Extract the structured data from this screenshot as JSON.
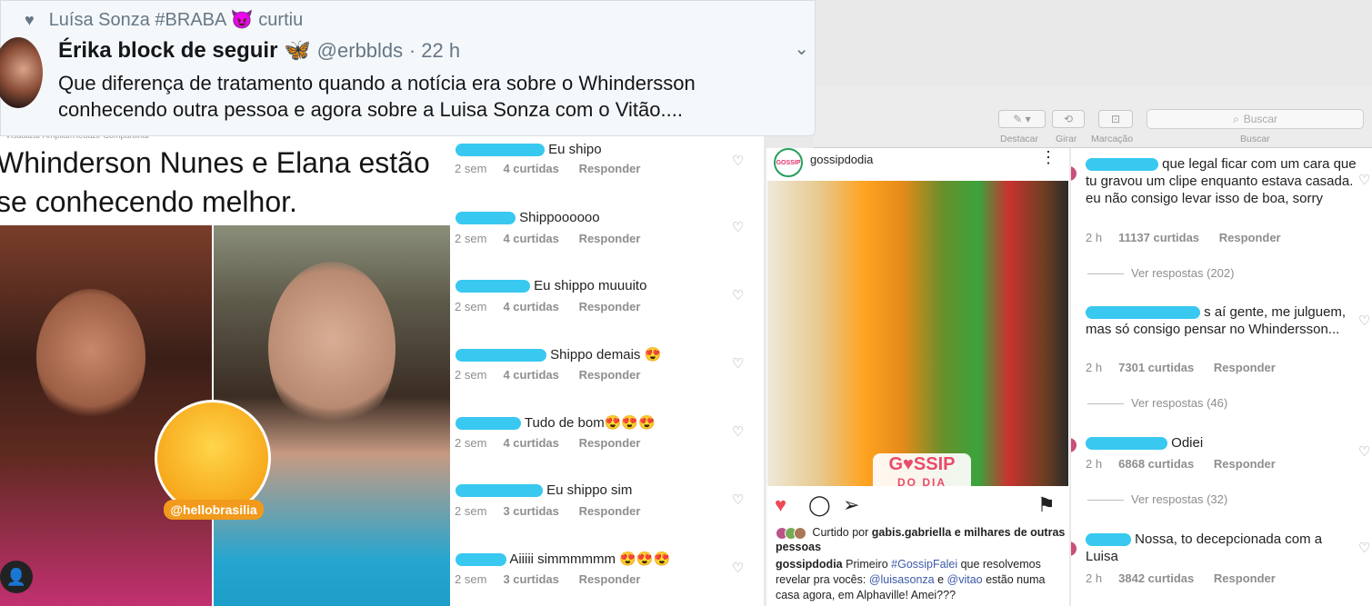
{
  "tweet": {
    "liked_by": "Luísa Sonza #BRABA",
    "liked_emoji": "😈",
    "liked_action": "curtiu",
    "author_name": "Érika block de seguir",
    "author_emoji": "🦋",
    "handle": "@erbblds",
    "time": "· 22 h",
    "text": "Que diferença de tratamento quando a notícia era sobre o Whindersson conhecendo outra pessoa e agora sobre a Luisa Sonza com o Vitão...."
  },
  "preview_toolbar": {
    "buttons": [
      "Destacar",
      "Girar",
      "Marcação",
      "Buscar"
    ],
    "search_placeholder": "Buscar"
  },
  "article": {
    "mini_toolbar": "Visualizar   Ampliar/Reduzir   Compartilhar",
    "headline_line1": "Whinderson Nunes e Elana estão",
    "headline_line2": "se conhecendo melhor.",
    "badge_label": "@hellobrasilia"
  },
  "comments_left": [
    {
      "text": "Eu shipo",
      "time": "2 sem",
      "likes": "4 curtidas",
      "reply": "Responder",
      "blur_w": 60,
      "top_partial": true
    },
    {
      "text": "Shippoooooo",
      "time": "2 sem",
      "likes": "4 curtidas",
      "reply": "Responder",
      "blur_w": 66
    },
    {
      "text": "Eu shippo muuuito",
      "time": "2 sem",
      "likes": "4 curtidas",
      "reply": "Responder",
      "blur_w": 80
    },
    {
      "text": "Shippo demais 😍",
      "time": "2 sem",
      "likes": "4 curtidas",
      "reply": "Responder",
      "blur_w": 100
    },
    {
      "text": "Tudo de bom😍😍😍",
      "time": "2 sem",
      "likes": "4 curtidas",
      "reply": "Responder",
      "blur_w": 72
    },
    {
      "text": "Eu shippo sim",
      "time": "2 sem",
      "likes": "3 curtidas",
      "reply": "Responder",
      "blur_w": 96
    },
    {
      "text": "Aiiiii simmmmmm 😍😍😍",
      "time": "2 sem",
      "likes": "3 curtidas",
      "reply": "Responder",
      "blur_w": 56
    }
  ],
  "post": {
    "username": "gossipdodia",
    "avatar_text": "GOSSIP",
    "watermark_line1": "G♥SSIP",
    "watermark_line2": "DO DIA",
    "liked_by_prefix": "Curtido por",
    "liked_by_user": "gabis.gabriella",
    "liked_by_suffix": "e milhares de outras pessoas",
    "caption_user": "gossipdodia",
    "caption_a": "Primeiro",
    "caption_tag": "#GossipFalei",
    "caption_b": "que resolvemos revelar pra vocês:",
    "mention1": "@luisasonza",
    "caption_c": "e",
    "mention2": "@vitao",
    "caption_d": "estão numa casa agora, em Alphaville! Amei???"
  },
  "comments_right": [
    {
      "text": "que legal ficar com um cara que tu gravou um clipe enquanto estava casada. eu não consigo levar isso de boa, sorry",
      "time": "2 h",
      "likes": "11137 curtidas",
      "reply": "Responder",
      "replies": "Ver respostas (202)"
    },
    {
      "text": "s aí gente, me julguem, mas só consigo pensar no Whindersson...",
      "time": "2 h",
      "likes": "7301 curtidas",
      "reply": "Responder",
      "replies": "Ver respostas (46)"
    },
    {
      "text": "Odiei",
      "time": "2 h",
      "likes": "6868 curtidas",
      "reply": "Responder",
      "replies": "Ver respostas (32)"
    },
    {
      "text": "Nossa, to decepcionada com a Luisa",
      "time": "2 h",
      "likes": "3842 curtidas",
      "reply": "Responder"
    }
  ],
  "colors": {
    "blur": "#38c8f0",
    "heart_red": "#ed4956",
    "twitter_gray": "#657786"
  }
}
